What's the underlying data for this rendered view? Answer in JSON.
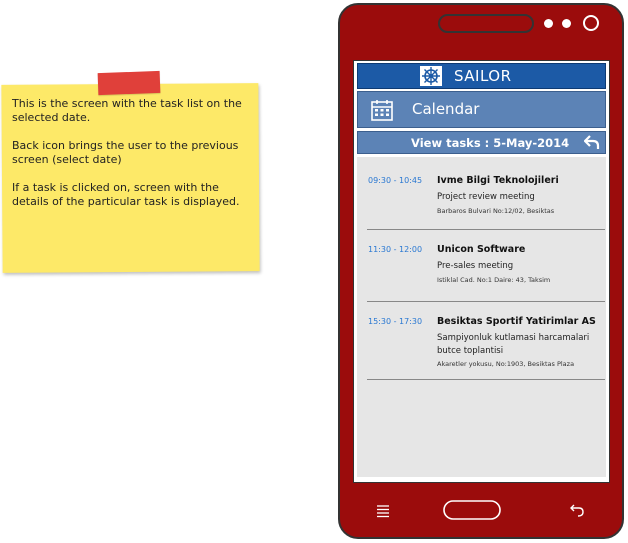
{
  "note": {
    "lines": [
      "This is the screen with the task list on the selected date.",
      "Back icon brings the user to the previous screen (select date)",
      "If a task is clicked on, screen with the details of the particular task is displayed."
    ]
  },
  "app": {
    "title": "SAILOR",
    "logo_icon": "ship-wheel-icon"
  },
  "calendar": {
    "title": "Calendar",
    "icon": "calendar-icon"
  },
  "view": {
    "title": "View tasks : 5-May-2014",
    "back_icon": "back-arrow-icon"
  },
  "tasks": [
    {
      "time": "09:30 - 10:45",
      "name": "Ivme Bilgi Teknolojileri",
      "description": "Project review meeting",
      "address": "Barbaros Bulvari No:12/02, Besiktas"
    },
    {
      "time": "11:30 - 12:00",
      "name": "Unicon Software",
      "description": "Pre-sales meeting",
      "address": "Istiklal Cad. No:1 Daire: 43, Taksim"
    },
    {
      "time": "15:30 - 17:30",
      "name": "Besiktas Sportif Yatirimlar AS",
      "description": "Sampiyonluk kutlamasi harcamalari butce toplantisi",
      "address": "Akaretler yokusu, No:1903, Besiktas Plaza"
    }
  ],
  "colors": {
    "phone": "#9b0c0c",
    "app_bar": "#1c5aa6",
    "sub_bar": "#5c83b6",
    "note": "#fde968",
    "time_text": "#2a78d2"
  }
}
